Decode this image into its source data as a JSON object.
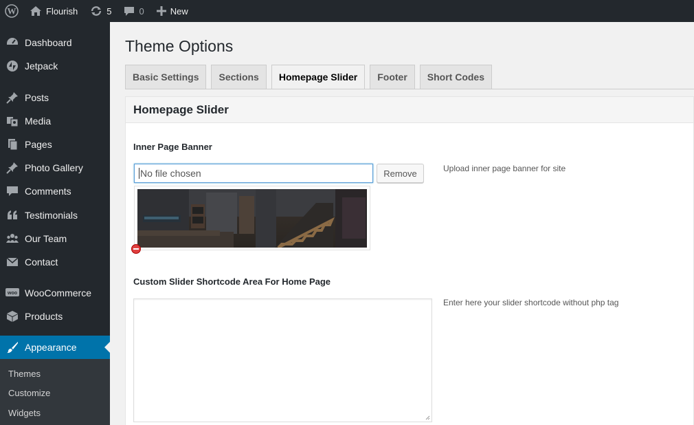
{
  "adminbar": {
    "site_name": "Flourish",
    "updates_count": "5",
    "comments_count": "0",
    "new_label": "New"
  },
  "sidebar": {
    "items": [
      {
        "label": "Dashboard",
        "icon": "dashboard-icon"
      },
      {
        "label": "Jetpack",
        "icon": "jetpack-icon"
      },
      {
        "label": "Posts",
        "icon": "pin-icon"
      },
      {
        "label": "Media",
        "icon": "media-icon"
      },
      {
        "label": "Pages",
        "icon": "pages-icon"
      },
      {
        "label": "Photo Gallery",
        "icon": "pin-icon"
      },
      {
        "label": "Comments",
        "icon": "comment-icon"
      },
      {
        "label": "Testimonials",
        "icon": "quote-icon"
      },
      {
        "label": "Our Team",
        "icon": "team-icon"
      },
      {
        "label": "Contact",
        "icon": "mail-icon"
      },
      {
        "label": "WooCommerce",
        "icon": "woocommerce-icon"
      },
      {
        "label": "Products",
        "icon": "box-icon"
      },
      {
        "label": "Appearance",
        "icon": "brush-icon",
        "active": true
      }
    ],
    "submenu": [
      "Themes",
      "Customize",
      "Widgets"
    ]
  },
  "main": {
    "title": "Theme Options",
    "tabs": [
      {
        "label": "Basic Settings"
      },
      {
        "label": "Sections"
      },
      {
        "label": "Homepage Slider",
        "active": true
      },
      {
        "label": "Footer"
      },
      {
        "label": "Short Codes"
      }
    ],
    "panel_title": "Homepage Slider",
    "banner": {
      "label": "Inner Page Banner",
      "file_value": "No file chosen",
      "remove_label": "Remove",
      "help": "Upload inner page banner for site"
    },
    "shortcode": {
      "label": "Custom Slider Shortcode Area For Home Page",
      "value": "",
      "help": "Enter here your slider shortcode without php tag"
    }
  },
  "colors": {
    "adminbar_bg": "#23282d",
    "active_menu": "#0073aa",
    "page_bg": "#f1f1f1"
  }
}
